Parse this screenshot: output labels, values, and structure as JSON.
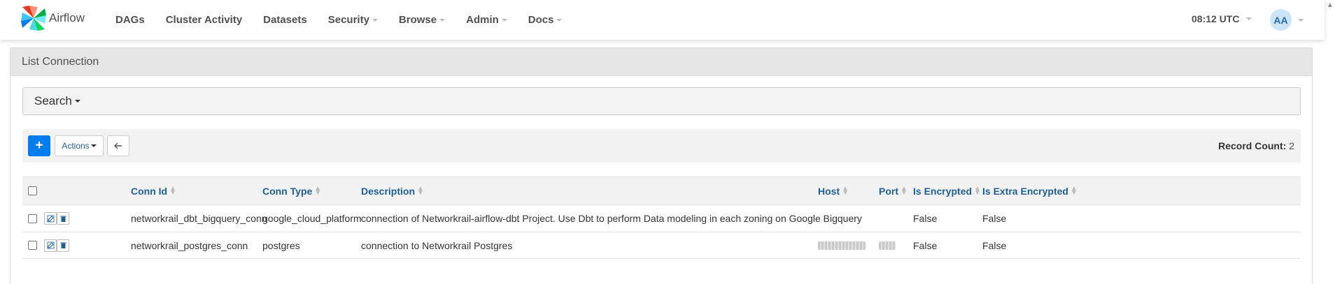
{
  "navbar": {
    "brand": "Airflow",
    "menu": [
      {
        "label": "DAGs",
        "dropdown": false
      },
      {
        "label": "Cluster Activity",
        "dropdown": false
      },
      {
        "label": "Datasets",
        "dropdown": false
      },
      {
        "label": "Security",
        "dropdown": true
      },
      {
        "label": "Browse",
        "dropdown": true
      },
      {
        "label": "Admin",
        "dropdown": true
      },
      {
        "label": "Docs",
        "dropdown": true
      }
    ],
    "clock": "08:12 UTC",
    "user_initials": "AA"
  },
  "panel": {
    "title": "List Connection",
    "search_label": "Search",
    "toolbar": {
      "actions_label": "Actions",
      "record_count_label": "Record Count:",
      "record_count": "2"
    }
  },
  "table": {
    "columns": [
      "Conn Id",
      "Conn Type",
      "Description",
      "Host",
      "Port",
      "Is Encrypted",
      "Is Extra Encrypted"
    ],
    "rows": [
      {
        "conn_id": "networkrail_dbt_bigquery_conn",
        "conn_type": "google_cloud_platform",
        "description": "connection of Networkrail-airflow-dbt Project. Use Dbt to perform Data modeling in each zoning on Google Bigquery",
        "host": "",
        "port": "",
        "is_encrypted": "False",
        "is_extra_encrypted": "False"
      },
      {
        "conn_id": "networkrail_postgres_conn",
        "conn_type": "postgres",
        "description": "connection to Networkrail Postgres",
        "host": "[redacted]",
        "port": "[redacted]",
        "is_encrypted": "False",
        "is_extra_encrypted": "False"
      }
    ]
  },
  "colors": {
    "accent": "#017cee",
    "link": "#1f5f99",
    "panel_heading": "#e6e6e6"
  }
}
